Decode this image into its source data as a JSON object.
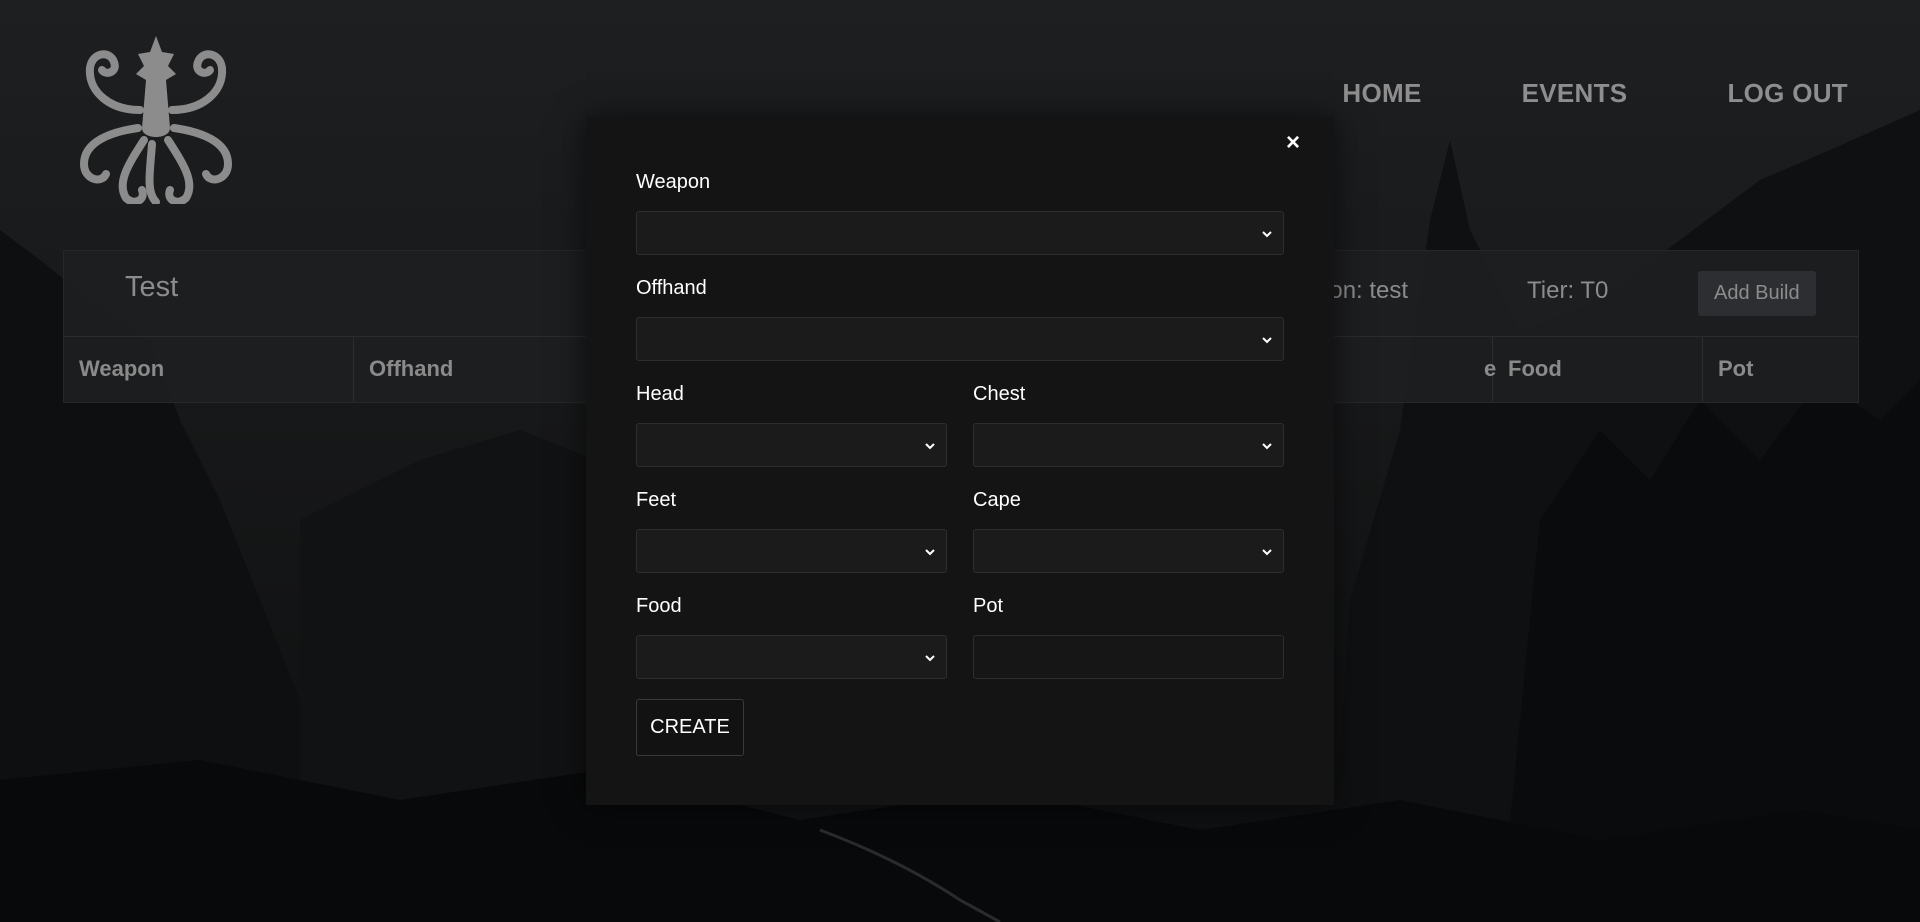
{
  "nav": {
    "home": "HOME",
    "events": "EVENTS",
    "logout": "LOG OUT"
  },
  "build": {
    "title": "Test",
    "location": "ation: test",
    "tier": "Tier: T0",
    "add_button": "Add Build",
    "columns": [
      "Weapon",
      "Offhand",
      "",
      "",
      "e",
      "Food",
      "Pot"
    ]
  },
  "modal": {
    "close": "×",
    "fields": {
      "weapon": "Weapon",
      "offhand": "Offhand",
      "head": "Head",
      "chest": "Chest",
      "feet": "Feet",
      "cape": "Cape",
      "food": "Food",
      "pot": "Pot"
    },
    "values": {
      "weapon": "",
      "offhand": "",
      "head": "",
      "chest": "",
      "feet": "",
      "cape": "",
      "food": "",
      "pot": ""
    },
    "create_button": "CREATE"
  },
  "icons": {
    "logo": "octopus-logo-icon",
    "dropdown": "chevron-down-icon"
  },
  "colors": {
    "background": "#141516",
    "modal": "#141414",
    "nav_text": "#8e8e8e"
  }
}
